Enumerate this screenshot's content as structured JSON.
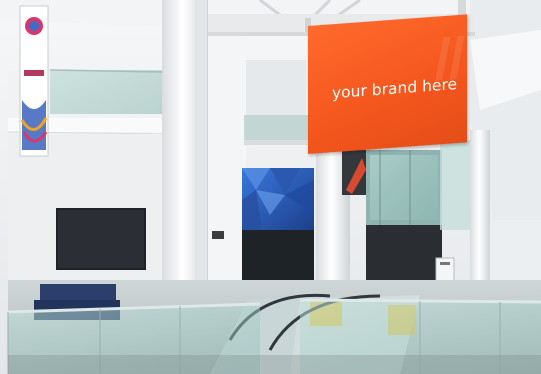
{
  "banner": {
    "text": "your brand here",
    "background_color": "#f4561d",
    "text_color": "#ffffff"
  },
  "colors": {
    "wall": "#eef0f2",
    "ceiling": "#f4f5f6",
    "glass_railing": "#a9c9c4",
    "screen": "#1f2226",
    "video_wall": "#2f64c8"
  }
}
